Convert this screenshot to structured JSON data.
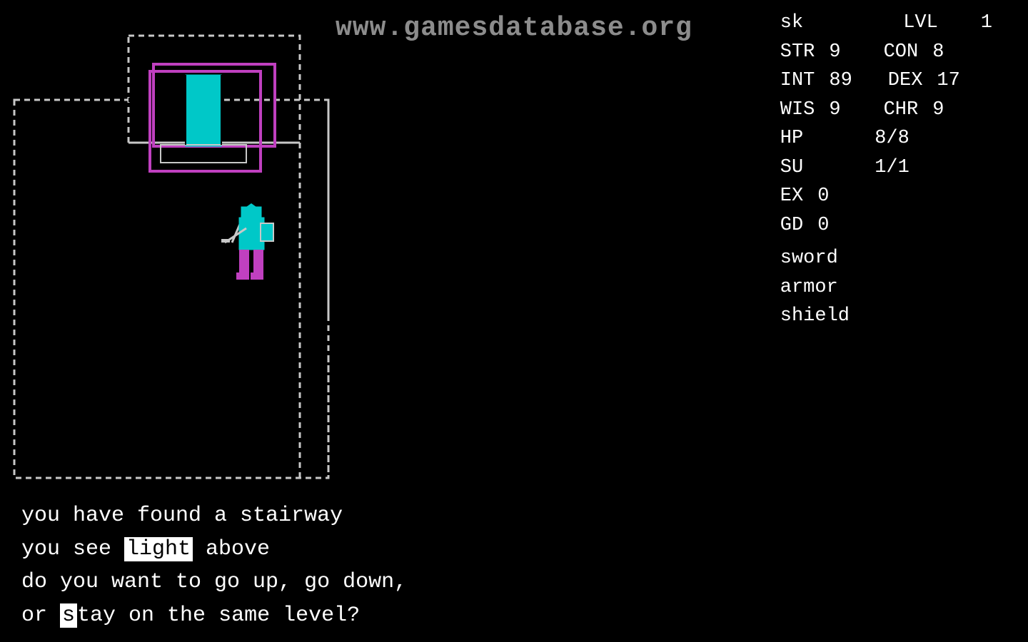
{
  "watermark": {
    "text": "www.gamesdatabase.org"
  },
  "stats": {
    "sk_label": "sk",
    "lvl_label": "LVL",
    "lvl_value": "1",
    "str_label": "STR",
    "str_value": "9",
    "con_label": "CON",
    "con_value": "8",
    "int_label": "INT",
    "int_value": "89",
    "dex_label": "DEX",
    "dex_value": "17",
    "wis_label": "WIS",
    "wis_value": "9",
    "chr_label": "CHR",
    "chr_value": "9",
    "hp_label": "HP",
    "hp_value": "8/8",
    "su_label": "SU",
    "su_value": "1/1",
    "ex_label": "EX",
    "ex_value": "0",
    "gd_label": "GD",
    "gd_value": "0",
    "item1": "sword",
    "item2": "armor",
    "item3": "shield"
  },
  "messages": {
    "line1": "you have found a stairway",
    "line2_pre": "you see ",
    "line2_highlight": "light",
    "line2_post": " above",
    "line3": "do you want to go up, go down,",
    "line4_pre": "or ",
    "line4_highlight": "s",
    "line4_post": "tay on the same level?"
  },
  "colors": {
    "wall": "#c8c8c8",
    "player_body": "#00c8c8",
    "player_legs": "#c040c0",
    "object_outline": "#c040c0",
    "object_fill": "#00c8c8",
    "text": "#ffffff",
    "highlight_bg": "#ffffff",
    "highlight_fg": "#000000"
  }
}
